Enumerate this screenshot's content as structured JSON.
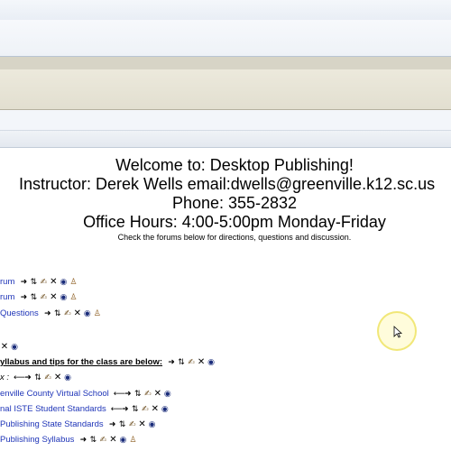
{
  "welcome": {
    "line1": "Welcome to: Desktop Publishing!",
    "line2": "Instructor: Derek Wells  email:dwells@greenville.k12.sc.us",
    "line3": "Phone: 355-2832",
    "line4": "Office Hours: 4:00-5:00pm Monday-Friday",
    "note": "Check the forums below for directions, questions and discussion."
  },
  "items": [
    {
      "label": "rum",
      "kind": "link"
    },
    {
      "label": "rum",
      "kind": "link"
    },
    {
      "label": "Questions",
      "kind": "link"
    },
    {
      "label": "",
      "kind": "blank"
    },
    {
      "label": "yllabus and tips for the class are below:",
      "kind": "heading"
    },
    {
      "label": "x :",
      "kind": "text"
    },
    {
      "label": "enville County Virtual School",
      "kind": "link"
    },
    {
      "label": "nal ISTE Student Standards",
      "kind": "link"
    },
    {
      "label": " Publishing State Standards",
      "kind": "link"
    },
    {
      "label": " Publishing Syllabus",
      "kind": "link"
    }
  ],
  "icons": {
    "move": "move-icon",
    "move_updown": "move-updown-icon",
    "edit": "edit-icon",
    "delete": "delete-icon",
    "hide": "hide-icon",
    "roles": "assign-roles-icon",
    "indent_left": "indent-left-icon",
    "indent_right": "indent-right-icon"
  }
}
